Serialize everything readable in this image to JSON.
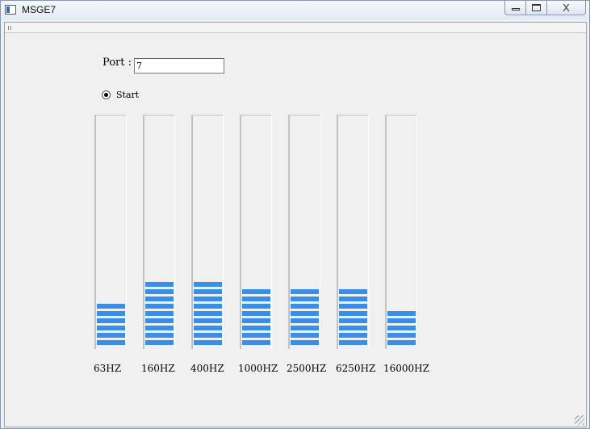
{
  "window": {
    "title": "MSGE7",
    "close_glyph": "X"
  },
  "port": {
    "label": "Port :",
    "value": "7"
  },
  "start": {
    "label": "Start",
    "checked": true
  },
  "accent_color": "#3a8ee6",
  "meters": [
    {
      "label": "63HZ",
      "level_bars": 6
    },
    {
      "label": "160HZ",
      "level_bars": 9
    },
    {
      "label": "400HZ",
      "level_bars": 9
    },
    {
      "label": "1000HZ",
      "level_bars": 8
    },
    {
      "label": "2500HZ",
      "level_bars": 8
    },
    {
      "label": "6250HZ",
      "level_bars": 8
    },
    {
      "label": "16000HZ",
      "level_bars": 5
    }
  ]
}
